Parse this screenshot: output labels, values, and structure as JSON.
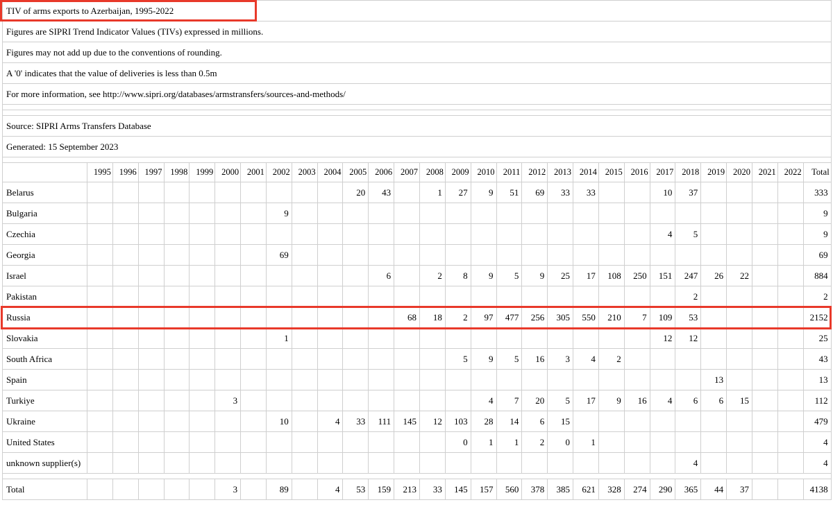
{
  "title": "TIV of arms exports to Azerbaijan, 1995-2022",
  "notes": [
    "Figures are SIPRI Trend Indicator Values (TIVs) expressed in millions.",
    "Figures may not add up due to the conventions of rounding.",
    "A '0' indicates that the value of deliveries is less than 0.5m",
    "For more information, see http://www.sipri.org/databases/armstransfers/sources-and-methods/"
  ],
  "source": "Source: SIPRI Arms Transfers Database",
  "generated": "Generated: 15 September 2023",
  "columns": [
    "1995",
    "1996",
    "1997",
    "1998",
    "1999",
    "2000",
    "2001",
    "2002",
    "2003",
    "2004",
    "2005",
    "2006",
    "2007",
    "2008",
    "2009",
    "2010",
    "2011",
    "2012",
    "2013",
    "2014",
    "2015",
    "2016",
    "2017",
    "2018",
    "2019",
    "2020",
    "2021",
    "2022",
    "Total"
  ],
  "rows": [
    {
      "name": "Belarus",
      "values": [
        "",
        "",
        "",
        "",
        "",
        "",
        "",
        "",
        "",
        "",
        "20",
        "43",
        "",
        "1",
        "27",
        "9",
        "51",
        "69",
        "33",
        "33",
        "",
        "",
        "10",
        "37",
        "",
        "",
        "",
        "",
        "333"
      ]
    },
    {
      "name": "Bulgaria",
      "values": [
        "",
        "",
        "",
        "",
        "",
        "",
        "",
        "9",
        "",
        "",
        "",
        "",
        "",
        "",
        "",
        "",
        "",
        "",
        "",
        "",
        "",
        "",
        "",
        "",
        "",
        "",
        "",
        "",
        "9"
      ]
    },
    {
      "name": "Czechia",
      "values": [
        "",
        "",
        "",
        "",
        "",
        "",
        "",
        "",
        "",
        "",
        "",
        "",
        "",
        "",
        "",
        "",
        "",
        "",
        "",
        "",
        "",
        "",
        "4",
        "5",
        "",
        "",
        "",
        "",
        "9"
      ]
    },
    {
      "name": "Georgia",
      "values": [
        "",
        "",
        "",
        "",
        "",
        "",
        "",
        "69",
        "",
        "",
        "",
        "",
        "",
        "",
        "",
        "",
        "",
        "",
        "",
        "",
        "",
        "",
        "",
        "",
        "",
        "",
        "",
        "",
        "69"
      ]
    },
    {
      "name": "Israel",
      "values": [
        "",
        "",
        "",
        "",
        "",
        "",
        "",
        "",
        "",
        "",
        "",
        "6",
        "",
        "2",
        "8",
        "9",
        "5",
        "9",
        "25",
        "17",
        "108",
        "250",
        "151",
        "247",
        "26",
        "22",
        "",
        "",
        "884"
      ]
    },
    {
      "name": "Pakistan",
      "values": [
        "",
        "",
        "",
        "",
        "",
        "",
        "",
        "",
        "",
        "",
        "",
        "",
        "",
        "",
        "",
        "",
        "",
        "",
        "",
        "",
        "",
        "",
        "",
        "2",
        "",
        "",
        "",
        "",
        "2"
      ]
    },
    {
      "name": "Russia",
      "values": [
        "",
        "",
        "",
        "",
        "",
        "",
        "",
        "",
        "",
        "",
        "",
        "",
        "68",
        "18",
        "2",
        "97",
        "477",
        "256",
        "305",
        "550",
        "210",
        "7",
        "109",
        "53",
        "",
        "",
        "",
        "",
        "2152"
      ]
    },
    {
      "name": "Slovakia",
      "values": [
        "",
        "",
        "",
        "",
        "",
        "",
        "",
        "1",
        "",
        "",
        "",
        "",
        "",
        "",
        "",
        "",
        "",
        "",
        "",
        "",
        "",
        "",
        "12",
        "12",
        "",
        "",
        "",
        "",
        "25"
      ]
    },
    {
      "name": "South Africa",
      "values": [
        "",
        "",
        "",
        "",
        "",
        "",
        "",
        "",
        "",
        "",
        "",
        "",
        "",
        "",
        "5",
        "9",
        "5",
        "16",
        "3",
        "4",
        "2",
        "",
        "",
        "",
        "",
        "",
        "",
        "",
        "43"
      ]
    },
    {
      "name": "Spain",
      "values": [
        "",
        "",
        "",
        "",
        "",
        "",
        "",
        "",
        "",
        "",
        "",
        "",
        "",
        "",
        "",
        "",
        "",
        "",
        "",
        "",
        "",
        "",
        "",
        "",
        "13",
        "",
        "",
        "",
        "13"
      ]
    },
    {
      "name": "Turkiye",
      "values": [
        "",
        "",
        "",
        "",
        "",
        "3",
        "",
        "",
        "",
        "",
        "",
        "",
        "",
        "",
        "",
        "4",
        "7",
        "20",
        "5",
        "17",
        "9",
        "16",
        "4",
        "6",
        "6",
        "15",
        "",
        "",
        "112"
      ]
    },
    {
      "name": "Ukraine",
      "values": [
        "",
        "",
        "",
        "",
        "",
        "",
        "",
        "10",
        "",
        "4",
        "33",
        "111",
        "145",
        "12",
        "103",
        "28",
        "14",
        "6",
        "15",
        "",
        "",
        "",
        "",
        "",
        "",
        "",
        "",
        "",
        "479"
      ]
    },
    {
      "name": "United States",
      "values": [
        "",
        "",
        "",
        "",
        "",
        "",
        "",
        "",
        "",
        "",
        "",
        "",
        "",
        "",
        "0",
        "1",
        "1",
        "2",
        "0",
        "1",
        "",
        "",
        "",
        "",
        "",
        "",
        "",
        "",
        "4"
      ]
    },
    {
      "name": "unknown supplier(s)",
      "values": [
        "",
        "",
        "",
        "",
        "",
        "",
        "",
        "",
        "",
        "",
        "",
        "",
        "",
        "",
        "",
        "",
        "",
        "",
        "",
        "",
        "",
        "",
        "",
        "4",
        "",
        "",
        "",
        "",
        "4"
      ]
    }
  ],
  "total": {
    "name": "Total",
    "values": [
      "",
      "",
      "",
      "",
      "",
      "3",
      "",
      "89",
      "",
      "4",
      "53",
      "159",
      "213",
      "33",
      "145",
      "157",
      "560",
      "378",
      "385",
      "621",
      "328",
      "274",
      "290",
      "365",
      "44",
      "37",
      "",
      "",
      "4138"
    ]
  },
  "highlight_color": "#e8392a"
}
